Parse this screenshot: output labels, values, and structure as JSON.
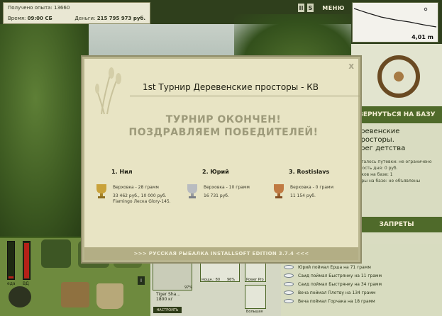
{
  "info": {
    "experience": "Получено опыта: 13660",
    "time_label": "Время:",
    "time_value": "09:00 СБ",
    "money_label": "Деньги:",
    "money_value": "215 795 973 руб."
  },
  "controls": {
    "pause": "II",
    "sound": "S",
    "menu": "МЕНЮ"
  },
  "depth": {
    "value": "4,01 m"
  },
  "right_panel": {
    "back_button": "ВЕРНУТЬСЯ НА БАЗУ",
    "location_title": "еревенские просторы.",
    "location_subtitle": "ерег детства",
    "info_lines": [
      "осталось путевки: не ограничено",
      "рмость дня: 0 руб.",
      "баков на базе: 1",
      "арры на базе: не объявлены"
    ],
    "bans_button": "ЗАПРЕТЫ"
  },
  "catch_log": [
    "Юрий поймал Ерша на 71 грамм",
    "Саид поймал Быстрянку на 11 грамм",
    "Саид поймал Быстрянку на 34 грамм",
    "Веча поймал Плотву на 134 грамм",
    "Веча поймал Горчака на 18 грамм"
  ],
  "gauges": {
    "left_label": "еда",
    "right_label": "ВД",
    "left_level": 0.05,
    "right_level": 0.95
  },
  "tackle": {
    "name": "Tiger Sha...",
    "weight": "1800 кг",
    "setup_button": "НАСТРОИТЬ",
    "pct1": "97%",
    "pct2": "96%",
    "label_mid": "мощн.: 80",
    "label_right": "Power Pro",
    "label_bottom": "Большая"
  },
  "modal": {
    "title": "1st Турнир Деревенские просторы - КВ",
    "close": "x",
    "headline1": "ТУРНИР ОКОНЧЕН!",
    "headline2": "ПОЗДРАВЛЯЕМ ПОБЕДИТЕЛЕЙ!",
    "winners": [
      {
        "place": "1. Нил",
        "line1": "Верховка - 28 грамм",
        "line2": "33 462 руб., 10 000 руб.",
        "line3": "Flamingo Леска Glory-145."
      },
      {
        "place": "2. Юрий",
        "line1": "Верховка - 10 грамм",
        "line2": "16 731 руб.",
        "line3": ""
      },
      {
        "place": "3. Rostislavs",
        "line1": "Верховка - 0 грамм",
        "line2": "11 154 руб.",
        "line3": ""
      }
    ],
    "footer": ">>> РУССКАЯ РЫБАЛКА INSTALLSOFT EDITION 3.7.4 <<<"
  },
  "colors": {
    "panel_green": "#4f6a2a",
    "modal_bg": "#e8e4c4",
    "gold_cup": "#c9a23a",
    "silver_cup": "#b9bcc0",
    "bronze_cup": "#c07a42"
  }
}
